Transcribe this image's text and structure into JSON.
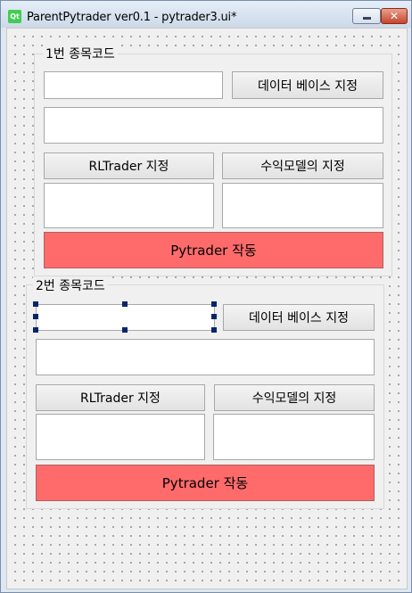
{
  "window": {
    "title": "ParentPytrader ver0.1 - pytrader3.ui*",
    "app_icon": "qt-logo-icon",
    "app_icon_text": "Qt",
    "minimize_icon": "minimize-icon",
    "close_icon": "close-icon",
    "close_glyph": "✕"
  },
  "group1": {
    "title": "1번 종목코드",
    "code_input": "",
    "database_button": "데이터 베이스 지정",
    "database_path": "",
    "rltrader_button": "RLTrader 지정",
    "model_button": "수익모델의 지정",
    "rltrader_path": "",
    "model_path": "",
    "run_button": "Pytrader 작동"
  },
  "group2": {
    "title": "2번 종목코드",
    "code_input": "",
    "database_button": "데이터 베이스 지정",
    "database_path": "",
    "rltrader_button": "RLTrader 지정",
    "model_button": "수익모델의 지정",
    "rltrader_path": "",
    "model_path": "",
    "run_button": "Pytrader 작동"
  },
  "colors": {
    "run_button": "#ff6b6b",
    "selection_handle": "#0a246a",
    "qt_logo": "#41cd52"
  }
}
